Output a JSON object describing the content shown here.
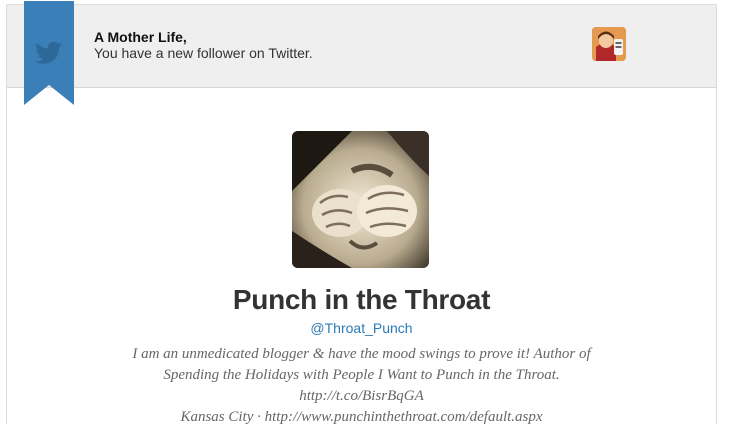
{
  "notification": {
    "recipient": "A Mother Life,",
    "message": "You have a new follower on Twitter.",
    "ribbon_icon": "twitter-bird-icon",
    "accent_color": "#3a7fb8"
  },
  "profile": {
    "name": "Punch in the Throat",
    "handle": "@Throat_Punch",
    "bio_lines": [
      "I am an unmedicated blogger & have the mood swings to prove it! Author of",
      "Spending the Holidays with People I Want to Punch in the Throat.",
      "http://t.co/BisrBqGA",
      "Kansas City · http://www.punchinthethroat.com/default.aspx"
    ]
  }
}
